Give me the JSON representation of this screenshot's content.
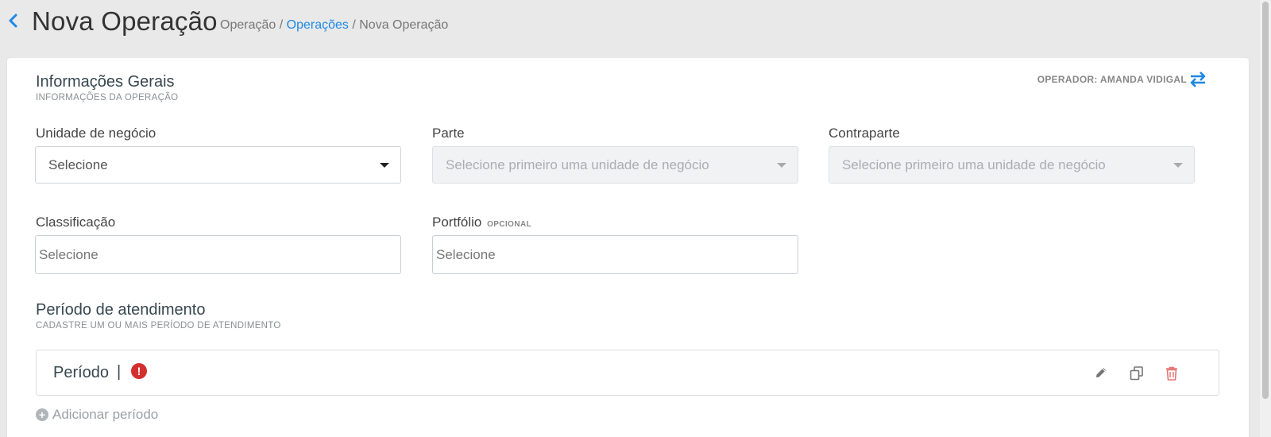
{
  "header": {
    "title": "Nova Operação",
    "breadcrumb": {
      "root": "Operação",
      "sep1": "/",
      "link": "Operações",
      "sep2": "/",
      "current": "Nova Operação"
    }
  },
  "general": {
    "title": "Informações Gerais",
    "subtitle": "INFORMAÇÕES DA OPERAÇÃO",
    "operator": "OPERADOR: AMANDA VIDIGAL"
  },
  "fields": {
    "business_unit": {
      "label": "Unidade de negócio",
      "value": "Selecione"
    },
    "party": {
      "label": "Parte",
      "value": "Selecione primeiro uma unidade de negócio"
    },
    "counterparty": {
      "label": "Contraparte",
      "value": "Selecione primeiro uma unidade de negócio"
    },
    "classification": {
      "label": "Classificação",
      "placeholder": "Selecione"
    },
    "portfolio": {
      "label": "Portfólio",
      "optional": "OPCIONAL",
      "placeholder": "Selecione"
    }
  },
  "service_period": {
    "title": "Período de atendimento",
    "subtitle": "CADASTRE UM OU MAIS PERÍODO DE ATENDIMENTO",
    "period_label": "Período",
    "separator": "|",
    "alert": "!",
    "add_label": "Adicionar período",
    "add_icon": "+"
  },
  "colors": {
    "accent": "#1e88e5",
    "alert": "#d32f2f",
    "delete": "#e57373"
  }
}
